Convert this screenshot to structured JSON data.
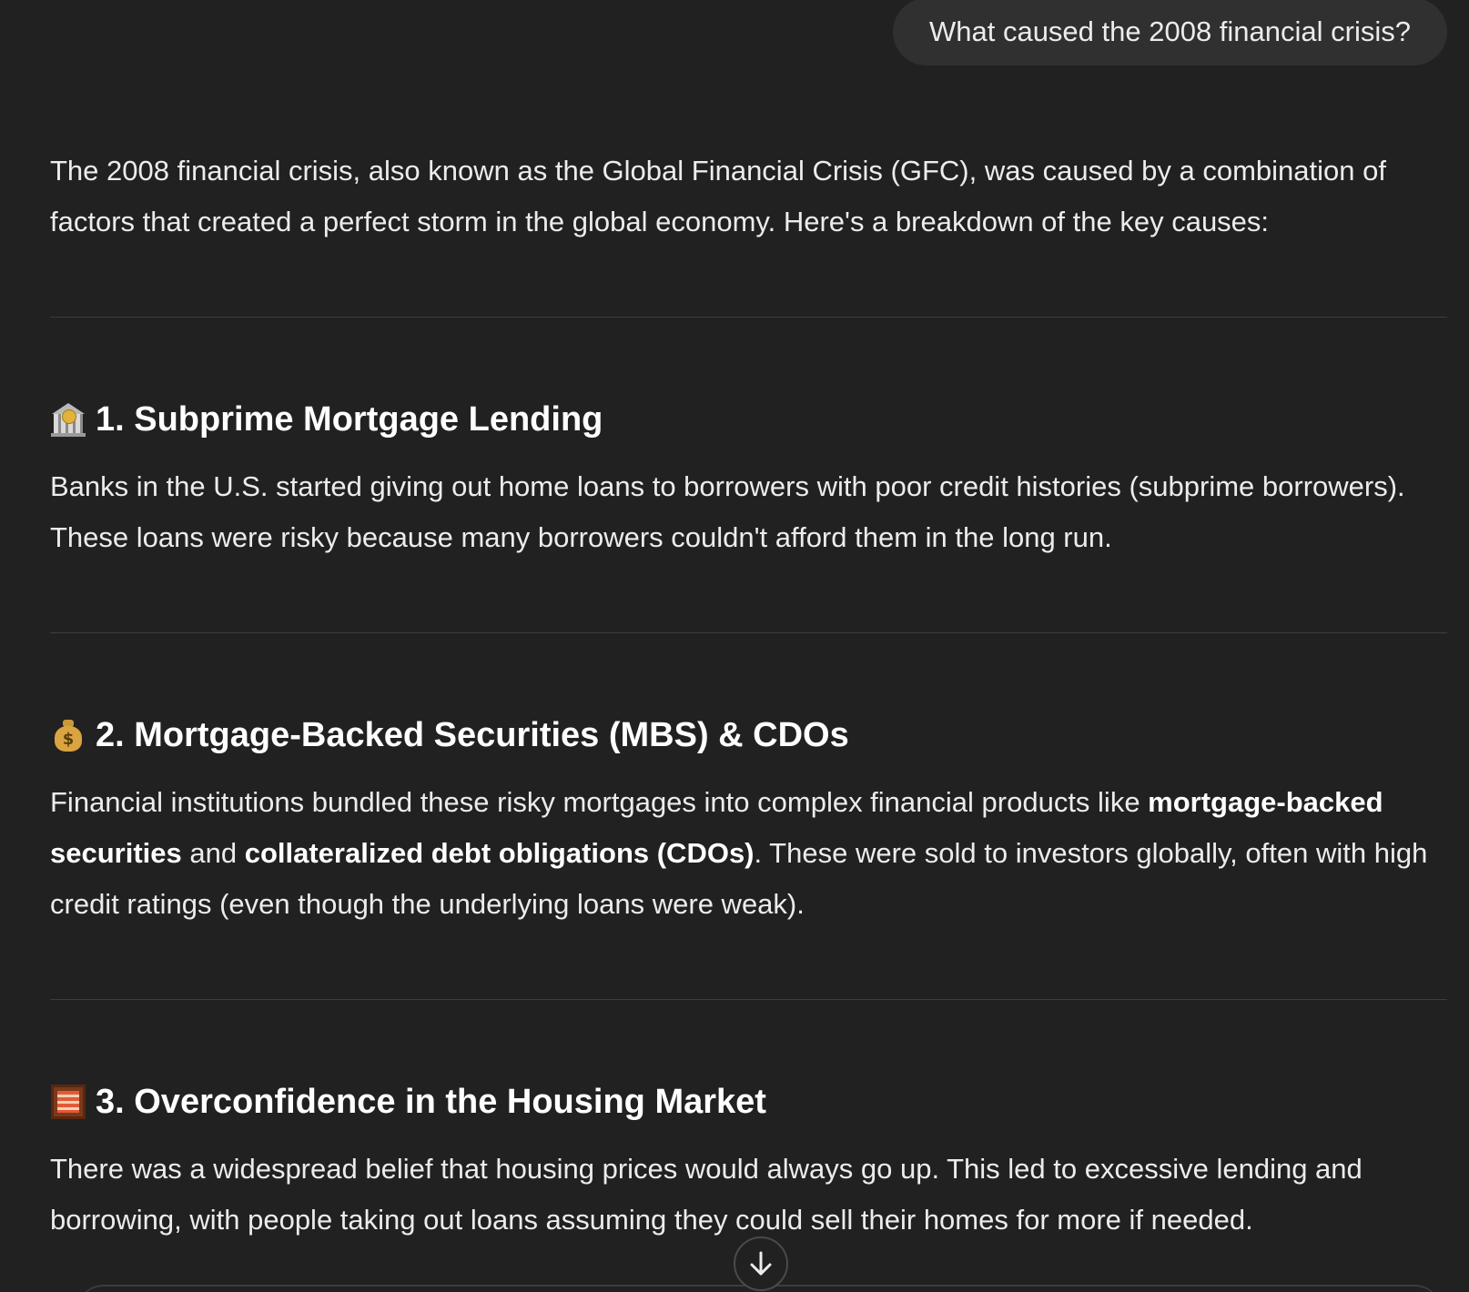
{
  "user_message": {
    "text": "What caused the 2008 financial crisis?"
  },
  "assistant": {
    "intro": "The 2008 financial crisis, also known as the Global Financial Crisis (GFC), was caused by a combination of factors that created a perfect storm in the global economy. Here's a breakdown of the key causes:",
    "sections": [
      {
        "icon": "bank-icon",
        "heading": "1. Subprime Mortgage Lending",
        "body": "Banks in the U.S. started giving out home loans to borrowers with poor credit histories (subprime borrowers). These loans were risky because many borrowers couldn't afford them in the long run."
      },
      {
        "icon": "money-bag-icon",
        "heading": "2. Mortgage-Backed Securities (MBS) & CDOs",
        "body_part1": "Financial institutions bundled these risky mortgages into complex financial products like ",
        "body_bold1": "mortgage-backed securities",
        "body_part2": " and ",
        "body_bold2": "collateralized debt obligations (CDOs)",
        "body_part3": ". These were sold to investors globally, often with high credit ratings (even though the underlying loans were weak)."
      },
      {
        "icon": "abacus-icon",
        "heading": "3. Overconfidence in the Housing Market",
        "body": "There was a widespread belief that housing prices would always go up. This led to excessive lending and borrowing, with people taking out loans assuming they could sell their homes for more if needed."
      }
    ]
  },
  "scroll_button": {
    "icon": "arrow-down-icon"
  }
}
